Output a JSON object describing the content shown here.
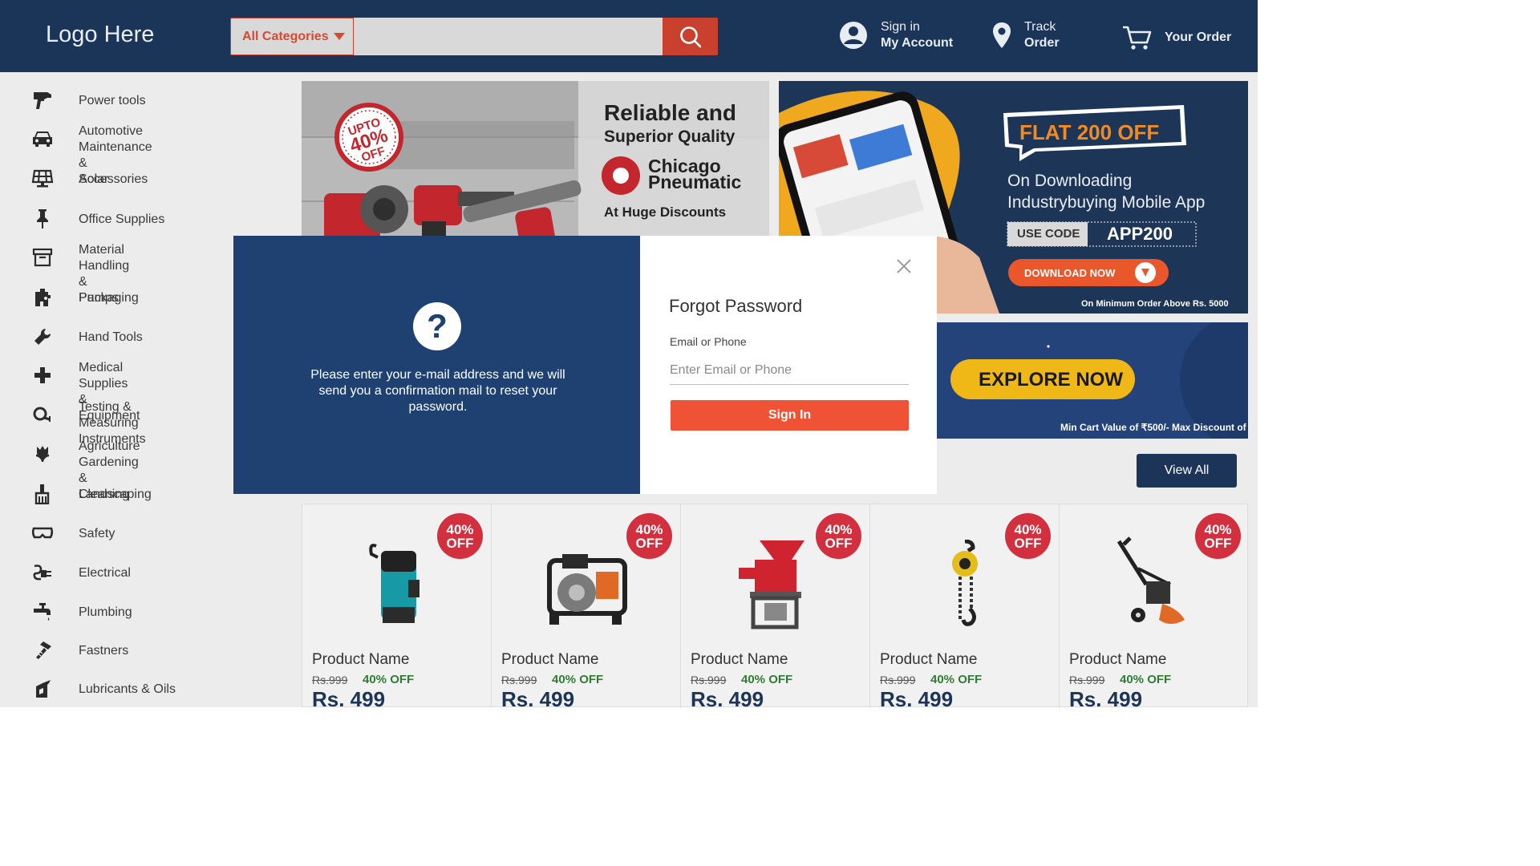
{
  "header": {
    "logo": "Logo Here",
    "category_button": "All Categories",
    "search_placeholder": "",
    "signin_line1": "Sign in",
    "signin_line2": "My Account",
    "track_line1": "Track",
    "track_line2": "Order",
    "order_label": "Your Order"
  },
  "sidebar": {
    "items": [
      {
        "label": "Power tools",
        "icon": "drill-icon"
      },
      {
        "label": "Automotive Maintenance &\nAccessories",
        "icon": "car-icon"
      },
      {
        "label": "Solar",
        "icon": "solar-panel-icon"
      },
      {
        "label": "Office Supplies",
        "icon": "pushpin-icon"
      },
      {
        "label": "Material Handling\n& Packaging",
        "icon": "box-icon"
      },
      {
        "label": "Pumps",
        "icon": "pump-icon"
      },
      {
        "label": "Hand Tools",
        "icon": "wrench-icon"
      },
      {
        "label": "Medical Supplies\n& Equipment",
        "icon": "medical-cross-icon"
      },
      {
        "label": "Testing & Measuring\nInstruments",
        "icon": "measuring-icon"
      },
      {
        "label": "Agriculture Gardening\n& Landscaping",
        "icon": "tulip-icon"
      },
      {
        "label": "Cleaning",
        "icon": "broom-icon"
      },
      {
        "label": "Safety",
        "icon": "goggles-icon"
      },
      {
        "label": "Electrical",
        "icon": "plug-icon"
      },
      {
        "label": "Plumbing",
        "icon": "faucet-icon"
      },
      {
        "label": "Fastners",
        "icon": "screw-icon"
      },
      {
        "label": "Lubricants & Oils",
        "icon": "oil-can-icon"
      }
    ]
  },
  "banners": {
    "b1_headline": "Reliable and",
    "b1_sub": "Superior Quality",
    "b1_brand1": "Chicago",
    "b1_brand2": "Pneumatic",
    "b1_tag": "At Huge Discounts",
    "b1_badge1": "UPTO",
    "b1_badge2": "40%",
    "b1_badge3": "OFF",
    "b2_flat": "FLAT 200 OFF",
    "b2_line1": "On Downloading",
    "b2_line2": "Industrybuying Mobile App",
    "b2_use": "USE CODE",
    "b2_code": "APP200",
    "b2_download": "DOWNLOAD NOW",
    "b2_min": "On Minimum Order Above Rs. 5000",
    "b3_explore": "EXPLORE NOW",
    "b3_min": "Min Cart Value of ₹500/- Max Discount of"
  },
  "products": {
    "view_all": "View All",
    "items": [
      {
        "name": "Product Name",
        "old": "Rs.999",
        "off": "40% OFF",
        "price": "Rs. 499",
        "badge1": "40%",
        "badge2": "OFF",
        "icon": "submersible-pump-icon"
      },
      {
        "name": "Product Name",
        "old": "Rs.999",
        "off": "40% OFF",
        "price": "Rs. 499",
        "badge1": "40%",
        "badge2": "OFF",
        "icon": "water-pump-icon"
      },
      {
        "name": "Product Name",
        "old": "Rs.999",
        "off": "40% OFF",
        "price": "Rs. 499",
        "badge1": "40%",
        "badge2": "OFF",
        "icon": "flour-mill-icon"
      },
      {
        "name": "Product Name",
        "old": "Rs.999",
        "off": "40% OFF",
        "price": "Rs. 499",
        "badge1": "40%",
        "badge2": "OFF",
        "icon": "chain-hoist-icon"
      },
      {
        "name": "Product Name",
        "old": "Rs.999",
        "off": "40% OFF",
        "price": "Rs. 499",
        "badge1": "40%",
        "badge2": "OFF",
        "icon": "tiller-icon"
      }
    ]
  },
  "modal": {
    "help_glyph": "?",
    "message": "Please enter your e-mail address and we will send you a confirmation mail to reset your password.",
    "title": "Forgot Password",
    "field_label": "Email or Phone",
    "field_placeholder": "Enter Email or Phone",
    "submit": "Sign In"
  },
  "colors": {
    "header_bg": "#1b3558",
    "accent": "#c9402e",
    "modal_left": "#1e4172",
    "submit": "#ef5235",
    "badge": "#d2303e"
  }
}
